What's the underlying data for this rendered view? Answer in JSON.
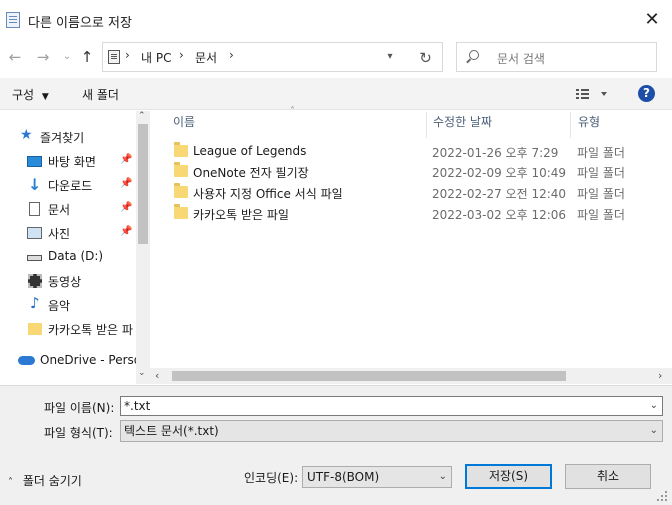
{
  "window": {
    "title": "다른 이름으로 저장"
  },
  "address": {
    "crumbs": [
      "내 PC",
      "문서"
    ]
  },
  "search": {
    "placeholder": "문서 검색"
  },
  "toolbar": {
    "organize": "구성",
    "new_folder": "새 폴더"
  },
  "sidebar": {
    "items": [
      {
        "label": "즐겨찾기",
        "icon": "star-icon",
        "pinned": false
      },
      {
        "label": "바탕 화면",
        "icon": "desktop-icon",
        "pinned": true
      },
      {
        "label": "다운로드",
        "icon": "download-arrow-icon",
        "pinned": true
      },
      {
        "label": "문서",
        "icon": "document-icon",
        "pinned": true
      },
      {
        "label": "사진",
        "icon": "picture-icon",
        "pinned": true
      },
      {
        "label": "Data (D:)",
        "icon": "drive-icon",
        "pinned": false
      },
      {
        "label": "동영상",
        "icon": "film-icon",
        "pinned": false
      },
      {
        "label": "음악",
        "icon": "music-note-icon",
        "pinned": false
      },
      {
        "label": "카카오톡 받은 파",
        "icon": "folder-icon",
        "pinned": false
      },
      {
        "label": "OneDrive - Perso",
        "icon": "cloud-icon",
        "pinned": false
      }
    ]
  },
  "columns": {
    "name": "이름",
    "date": "수정한 날짜",
    "type": "유형"
  },
  "files": [
    {
      "name": "League of Legends",
      "date": "2022-01-26 오후 7:29",
      "type": "파일 폴더"
    },
    {
      "name": "OneNote 전자 필기장",
      "date": "2022-02-09 오후 10:49",
      "type": "파일 폴더"
    },
    {
      "name": "사용자 지정 Office 서식 파일",
      "date": "2022-02-27 오전 12:40",
      "type": "파일 폴더"
    },
    {
      "name": "카카오톡 받은 파일",
      "date": "2022-03-02 오후 12:06",
      "type": "파일 폴더"
    }
  ],
  "form": {
    "filename_label": "파일 이름(N):",
    "filename_value": "*.txt",
    "filetype_label": "파일 형식(T):",
    "filetype_value": "텍스트 문서(*.txt)",
    "encoding_label": "인코딩(E):",
    "encoding_value": "UTF-8(BOM)",
    "hide_folders": "폴더 숨기기",
    "save": "저장(S)",
    "cancel": "취소"
  },
  "colors": {
    "help_blue": "#1e4fa8",
    "folder_yellow": "#f8d775",
    "accent": "#0078d7"
  }
}
